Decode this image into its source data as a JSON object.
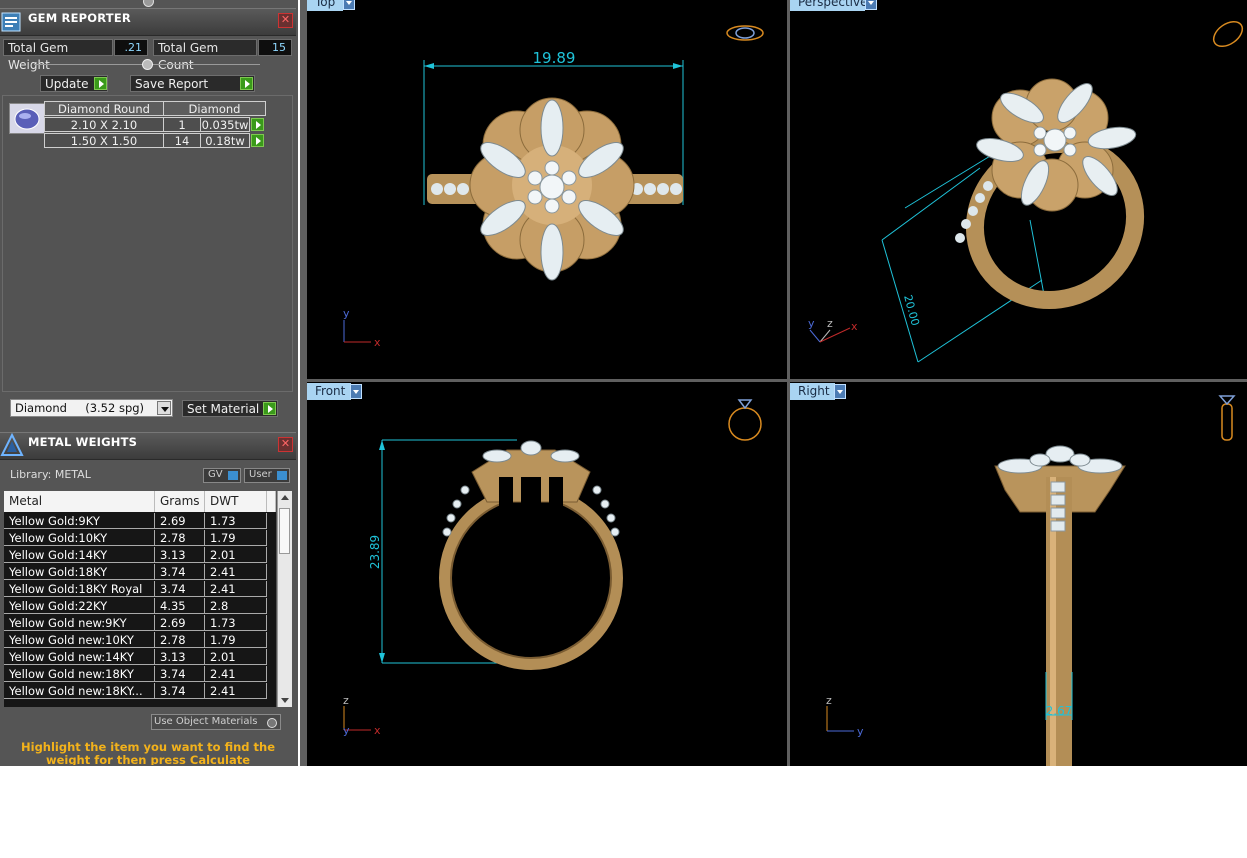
{
  "gem_reporter": {
    "title": "GEM REPORTER",
    "total_weight_label": "Total Gem Weight",
    "total_weight_value": ".21",
    "total_count_label": "Total Gem Count",
    "total_count_value": "15",
    "update_label": "Update",
    "save_report_label": "Save Report",
    "table_header_1": "Diamond Round",
    "table_header_2": "Diamond",
    "rows": [
      {
        "size": "2.10 X 2.10",
        "count": "1",
        "weight": "0.035tw"
      },
      {
        "size": "1.50 X 1.50",
        "count": "14",
        "weight": "0.18tw"
      }
    ],
    "material_select": "Diamond     (3.52 spg)",
    "set_material_label": "Set Material"
  },
  "metal_weights": {
    "title": "METAL WEIGHTS",
    "library_label": "Library: METAL",
    "gv_label": "GV",
    "user_label": "User",
    "columns": [
      "Metal",
      "Grams",
      "DWT"
    ],
    "rows": [
      {
        "metal": "Yellow Gold:9KY",
        "grams": "2.69",
        "dwt": "1.73"
      },
      {
        "metal": "Yellow Gold:10KY",
        "grams": "2.78",
        "dwt": "1.79"
      },
      {
        "metal": "Yellow Gold:14KY",
        "grams": "3.13",
        "dwt": "2.01"
      },
      {
        "metal": "Yellow Gold:18KY",
        "grams": "3.74",
        "dwt": "2.41"
      },
      {
        "metal": "Yellow Gold:18KY Royal",
        "grams": "3.74",
        "dwt": "2.41"
      },
      {
        "metal": "Yellow Gold:22KY",
        "grams": "4.35",
        "dwt": "2.8"
      },
      {
        "metal": "Yellow Gold new:9KY",
        "grams": "2.69",
        "dwt": "1.73"
      },
      {
        "metal": "Yellow Gold new:10KY",
        "grams": "2.78",
        "dwt": "1.79"
      },
      {
        "metal": "Yellow Gold new:14KY",
        "grams": "3.13",
        "dwt": "2.01"
      },
      {
        "metal": "Yellow Gold new:18KY",
        "grams": "3.74",
        "dwt": "2.41"
      },
      {
        "metal": "Yellow Gold new:18KY...",
        "grams": "3.74",
        "dwt": "2.41"
      }
    ],
    "use_object_label": "Use Object Materials",
    "hint": "Highlight the item you want to find the weight for then press Calculate"
  },
  "viewports": {
    "top": {
      "label": "Top",
      "dimension": "19.89",
      "axis_v": "y",
      "axis_h": "x"
    },
    "perspective": {
      "label": "Perspective",
      "dimension": "20.00",
      "axis_y": "y",
      "axis_z": "z",
      "axis_x": "x"
    },
    "front": {
      "label": "Front",
      "dimension": "23.89",
      "axis_v": "z",
      "axis_h": "x",
      "axis_depth": "y"
    },
    "right": {
      "label": "Right",
      "dimension": "2.67",
      "axis_v": "z",
      "axis_h": "y"
    }
  }
}
